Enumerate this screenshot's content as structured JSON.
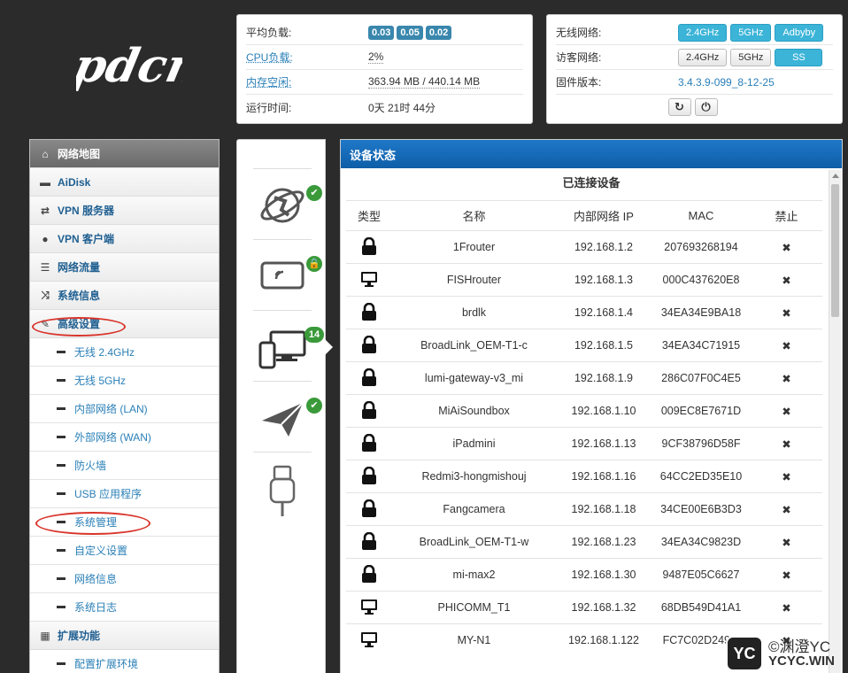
{
  "logo": "pdcn",
  "status": {
    "load_label": "平均负载:",
    "load_values": [
      "0.03",
      "0.05",
      "0.02"
    ],
    "cpu_label": "CPU负载:",
    "cpu_value": "2%",
    "mem_label": "内存空闲:",
    "mem_value": "363.94 MB / 440.14 MB",
    "uptime_label": "运行时间:",
    "uptime_value": "0天 21时 44分"
  },
  "network": {
    "wifi_label": "无线网络:",
    "wifi_buttons": [
      "2.4GHz",
      "5GHz",
      "Adbyby"
    ],
    "guest_label": "访客网络:",
    "guest_buttons": [
      "2.4GHz",
      "5GHz",
      "SS"
    ],
    "fw_label": "固件版本:",
    "fw_value": "3.4.3.9-099_8-12-25",
    "refresh_icon": "↻",
    "power_icon": "⏻"
  },
  "sidebar": {
    "items": [
      {
        "label": "网络地图",
        "icon": "home-icon"
      },
      {
        "label": "AiDisk",
        "icon": "disk-icon"
      },
      {
        "label": "VPN 服务器",
        "icon": "vpn-server-icon"
      },
      {
        "label": "VPN 客户端",
        "icon": "globe-icon"
      },
      {
        "label": "网络流量",
        "icon": "list-icon"
      },
      {
        "label": "系统信息",
        "icon": "shuffle-icon"
      },
      {
        "label": "高级设置",
        "icon": "wrench-icon"
      }
    ],
    "sub_items": [
      "无线 2.4GHz",
      "无线 5GHz",
      "内部网络 (LAN)",
      "外部网络 (WAN)",
      "防火墙",
      "USB 应用程序",
      "系统管理",
      "自定义设置",
      "网络信息",
      "系统日志"
    ],
    "ext_label": "扩展功能",
    "ext_sub": "配置扩展环境"
  },
  "iconcol": {
    "client_count": "14",
    "check_mark": "✔"
  },
  "devices": {
    "panel_title": "设备状态",
    "subtitle": "已连接设备",
    "headers": [
      "类型",
      "名称",
      "内部网络 IP",
      "MAC",
      "禁止"
    ],
    "rows": [
      {
        "type": "lock",
        "name": "1Frouter",
        "ip": "192.168.1.2",
        "mac": "207693268194"
      },
      {
        "type": "monitor",
        "name": "FISHrouter",
        "ip": "192.168.1.3",
        "mac": "000C437620E8"
      },
      {
        "type": "lock",
        "name": "brdlk",
        "ip": "192.168.1.4",
        "mac": "34EA34E9BA18"
      },
      {
        "type": "lock",
        "name": "BroadLink_OEM-T1-c",
        "ip": "192.168.1.5",
        "mac": "34EA34C71915"
      },
      {
        "type": "lock",
        "name": "lumi-gateway-v3_mi",
        "ip": "192.168.1.9",
        "mac": "286C07F0C4E5"
      },
      {
        "type": "lock",
        "name": "MiAiSoundbox",
        "ip": "192.168.1.10",
        "mac": "009EC8E7671D"
      },
      {
        "type": "lock",
        "name": "iPadmini",
        "ip": "192.168.1.13",
        "mac": "9CF38796D58F"
      },
      {
        "type": "lock",
        "name": "Redmi3-hongmishouj",
        "ip": "192.168.1.16",
        "mac": "64CC2ED35E10"
      },
      {
        "type": "lock",
        "name": "Fangcamera",
        "ip": "192.168.1.18",
        "mac": "34CE00E6B3D3"
      },
      {
        "type": "lock",
        "name": "BroadLink_OEM-T1-w",
        "ip": "192.168.1.23",
        "mac": "34EA34C9823D"
      },
      {
        "type": "lock",
        "name": "mi-max2",
        "ip": "192.168.1.30",
        "mac": "9487E05C6627"
      },
      {
        "type": "monitor",
        "name": "PHICOMM_T1",
        "ip": "192.168.1.32",
        "mac": "68DB549D41A1"
      },
      {
        "type": "monitor",
        "name": "MY-N1",
        "ip": "192.168.1.122",
        "mac": "FC7C02D249..."
      }
    ],
    "block_symbol": "✖"
  },
  "watermark": {
    "box": "YC",
    "line1": "©渊澄YC",
    "line2": "YCYC.WIN"
  }
}
